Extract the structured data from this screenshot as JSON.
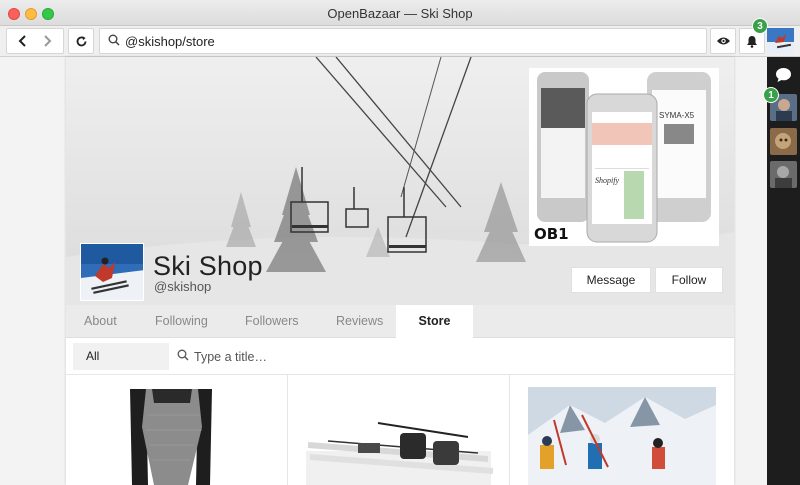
{
  "window": {
    "title": "OpenBazaar — Ski Shop"
  },
  "toolbar": {
    "address": "@skishop/store",
    "notification_count": "3"
  },
  "sidebar": {
    "avatar_badge": "1"
  },
  "banner": {
    "ad_logo": "OB1",
    "ad_phone_title": "SYMA-X5",
    "ad_phone_brand": "Shopify"
  },
  "header": {
    "shop_name": "Ski Shop",
    "handle": "@skishop",
    "message_label": "Message",
    "follow_label": "Follow"
  },
  "tabs": [
    {
      "label": "About"
    },
    {
      "label": "Following"
    },
    {
      "label": "Followers"
    },
    {
      "label": "Reviews"
    },
    {
      "label": "Store"
    }
  ],
  "store": {
    "filter_value": "All",
    "search_placeholder": "Type a title…"
  },
  "colors": {
    "badge": "#3aa14b",
    "sidebar": "#1d1d1d"
  }
}
